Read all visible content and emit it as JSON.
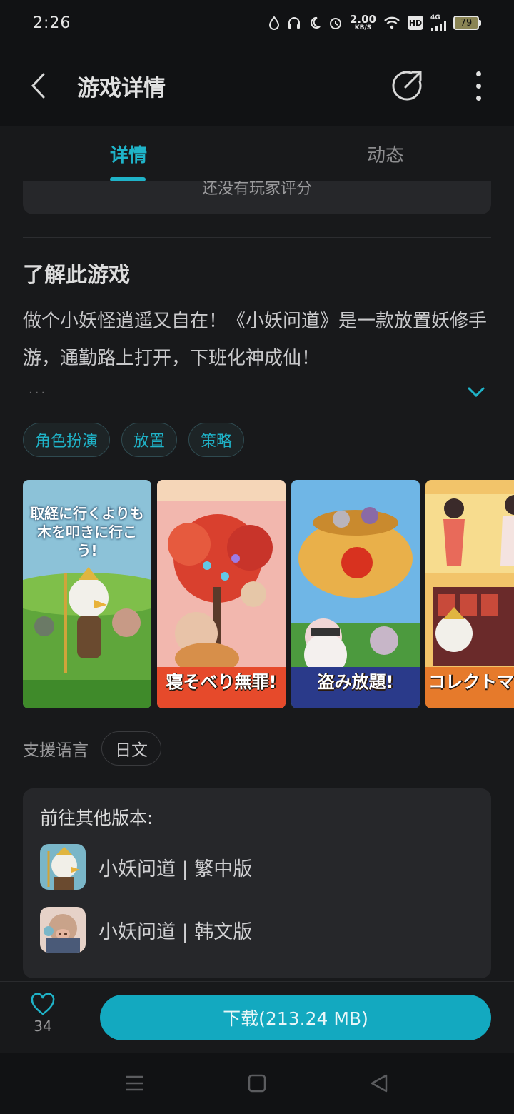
{
  "status": {
    "time": "2:26",
    "net_speed": "2.00",
    "net_unit": "KB/S",
    "hd": "HD",
    "signal": "4G",
    "battery": "79"
  },
  "app_bar": {
    "title": "游戏详情"
  },
  "tabs": [
    {
      "label": "详情",
      "active": true
    },
    {
      "label": "动态",
      "active": false
    }
  ],
  "rating": {
    "text": "还没有玩家评分"
  },
  "about": {
    "title": "了解此游戏",
    "description": "做个小妖怪逍遥又自在！《小妖问道》是一款放置妖修手游，通勤路上打开，下班化神成仙！",
    "ellipsis": "···"
  },
  "tags": [
    "角色扮演",
    "放置",
    "策略"
  ],
  "screenshots": [
    {
      "caption": "取経に行くよりも木を叩きに行こう!"
    },
    {
      "caption": "寝そべり無罪!"
    },
    {
      "caption": "盗み放題!"
    },
    {
      "caption": "コレクトマニ"
    }
  ],
  "language": {
    "label": "支援语言",
    "value": "日文"
  },
  "versions": {
    "title": "前往其他版本:",
    "items": [
      {
        "label": "小妖问道 | 繁中版"
      },
      {
        "label": "小妖问道 | 韩文版"
      }
    ]
  },
  "bottom": {
    "likes": "34",
    "download_label": "下载(213.24 MB)"
  },
  "colors": {
    "accent": "#1fb3c8",
    "background": "#18191b",
    "card": "#26272a"
  }
}
